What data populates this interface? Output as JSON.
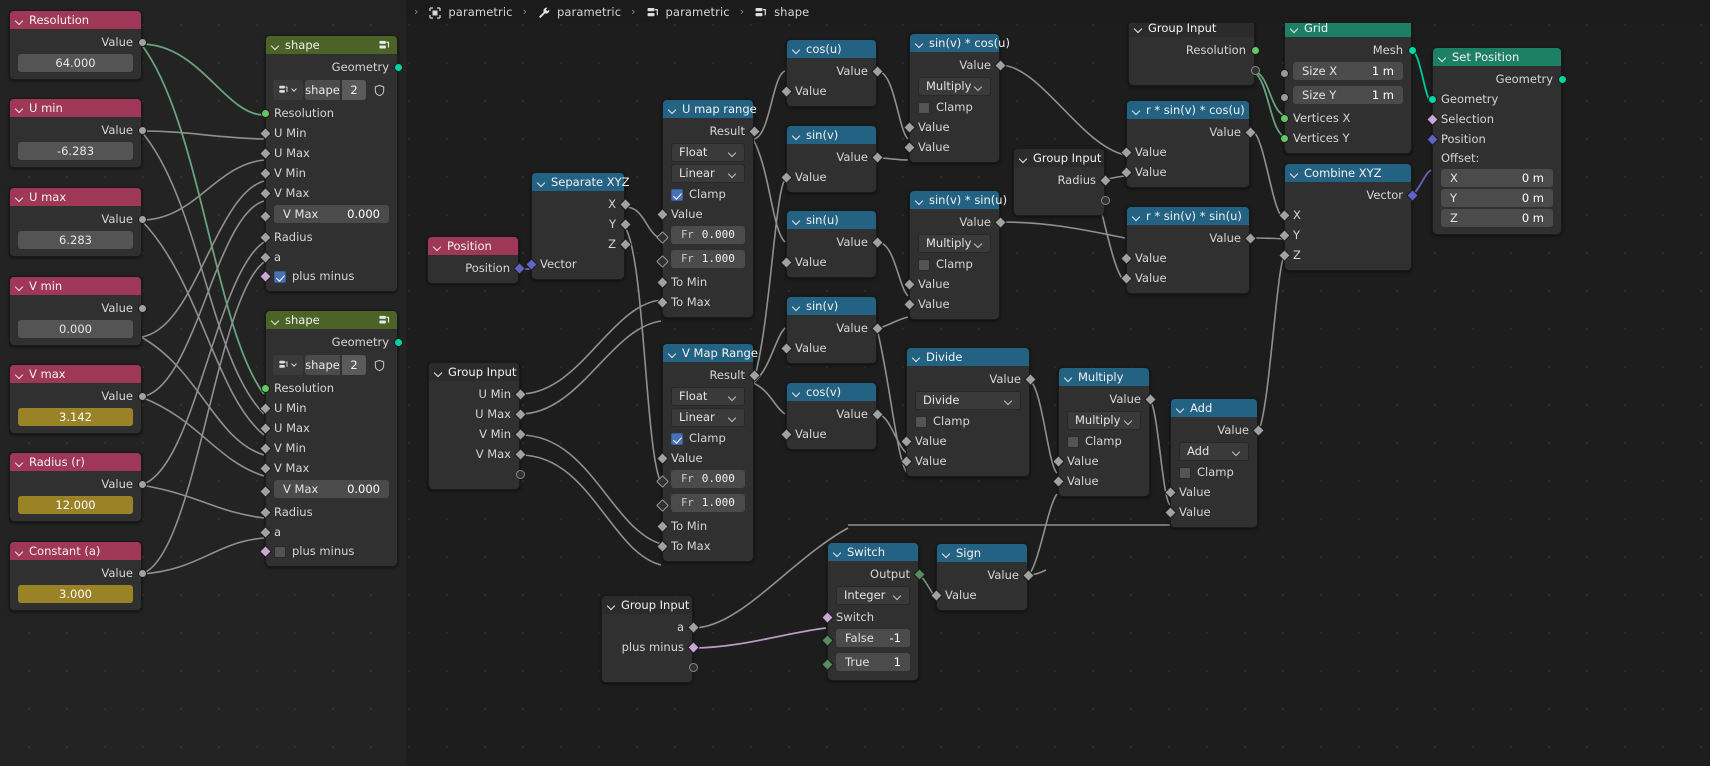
{
  "app": "blender-geometry-nodes",
  "breadcrumb": {
    "items": [
      {
        "icon": "object-icon",
        "label": "parametric"
      },
      {
        "icon": "wrench-icon",
        "label": "parametric"
      },
      {
        "icon": "nodetree-icon",
        "label": "parametric"
      },
      {
        "icon": "nodetree-icon",
        "label": "shape"
      }
    ],
    "separator": "›"
  },
  "colors": {
    "header_input": "#9f3759",
    "header_converter": "#246283",
    "header_geometry": "#1d8064",
    "header_group": "#4c6327",
    "header_groupinput": "#2b2b2b",
    "field_value": "#545454",
    "field_driven": "#9a8326",
    "socket_float": "#a1a1a1",
    "socket_geometry": "#00d6a3",
    "socket_vector": "#6363c7",
    "socket_boolean": "#cca6d6",
    "socket_integer": "#598c5c",
    "link_default": "#9a9a9a",
    "link_geometry": "#6fae86",
    "link_vector": "#6d6dc9",
    "link_boolean": "#c9a5d4"
  },
  "nodes": {
    "resolution": {
      "title": "Resolution",
      "out_label": "Value",
      "value": "64.000"
    },
    "u_min": {
      "title": "U min",
      "out_label": "Value",
      "value": "-6.283"
    },
    "u_max": {
      "title": "U max",
      "out_label": "Value",
      "value": "6.283"
    },
    "v_min": {
      "title": "V min",
      "out_label": "Value",
      "value": "0.000"
    },
    "v_max": {
      "title": "V max",
      "out_label": "Value",
      "value": "3.142"
    },
    "radius_r": {
      "title": "Radius (r)",
      "out_label": "Value",
      "value": "12.000"
    },
    "constant_a": {
      "title": "Constant (a)",
      "out_label": "Value",
      "value": "3.000"
    },
    "shape_group_1": {
      "title": "shape",
      "out_geometry": "Geometry",
      "id_name": "shape",
      "id_count": "2",
      "inputs": [
        "Resolution",
        "U Min",
        "U Max",
        "V Min",
        "V Max"
      ],
      "vmax_field": {
        "label": "V Max",
        "value": "0.000"
      },
      "inputs_tail": [
        "Radius",
        "a"
      ],
      "plus_minus": {
        "label": "plus minus",
        "checked": true
      }
    },
    "shape_group_2": {
      "title": "shape",
      "out_geometry": "Geometry",
      "id_name": "shape",
      "id_count": "2",
      "inputs": [
        "Resolution",
        "U Min",
        "U Max",
        "V Min",
        "V Max"
      ],
      "vmax_field": {
        "label": "V Max",
        "value": "0.000"
      },
      "inputs_tail": [
        "Radius",
        "a"
      ],
      "plus_minus": {
        "label": "plus minus",
        "checked": false
      }
    },
    "position": {
      "title": "Position",
      "out_label": "Position"
    },
    "separate_xyz": {
      "title": "Separate XYZ",
      "outputs": [
        "X",
        "Y",
        "Z"
      ],
      "input": "Vector"
    },
    "group_input_uv": {
      "title": "Group Input",
      "outputs": [
        "U Min",
        "U Max",
        "V Min",
        "V Max"
      ]
    },
    "group_input_radius": {
      "title": "Group Input",
      "outputs": [
        "Radius"
      ]
    },
    "group_input_resolution": {
      "title": "Group Input",
      "outputs": [
        "Resolution"
      ]
    },
    "group_input_a": {
      "title": "Group Input",
      "outputs": [
        "a",
        "plus minus"
      ]
    },
    "u_map_range": {
      "title": "U map range",
      "out_label": "Result",
      "data_type": "Float",
      "interpolation": "Linear",
      "clamp": {
        "label": "Clamp",
        "checked": true
      },
      "value_label": "Value",
      "from_min": {
        "prefix": "Fr",
        "value": "0.000"
      },
      "from_max": {
        "prefix": "Fr",
        "value": "1.000"
      },
      "to_min": "To Min",
      "to_max": "To Max"
    },
    "v_map_range": {
      "title": "V Map Range",
      "out_label": "Result",
      "data_type": "Float",
      "interpolation": "Linear",
      "clamp": {
        "label": "Clamp",
        "checked": true
      },
      "value_label": "Value",
      "from_min": {
        "prefix": "Fr",
        "value": "0.000"
      },
      "from_max": {
        "prefix": "Fr",
        "value": "1.000"
      },
      "to_min": "To Min",
      "to_max": "To Max"
    },
    "cos_u": {
      "title": "cos(u)",
      "out_label": "Value",
      "in_labels": [
        "Value"
      ]
    },
    "sin_v_a": {
      "title": "sin(v)",
      "out_label": "Value",
      "in_labels": [
        "Value"
      ]
    },
    "sin_u": {
      "title": "sin(u)",
      "out_label": "Value",
      "in_labels": [
        "Value"
      ]
    },
    "sin_v_b": {
      "title": "sin(v)",
      "out_label": "Value",
      "in_labels": [
        "Value"
      ]
    },
    "cos_v": {
      "title": "cos(v)",
      "out_label": "Value",
      "in_labels": [
        "Value"
      ]
    },
    "mul_sinv_cosu": {
      "title": "sin(v) * cos(u)",
      "out_label": "Value",
      "operation": "Multiply",
      "clamp": {
        "label": "Clamp",
        "checked": false
      },
      "in_labels": [
        "Value",
        "Value"
      ]
    },
    "mul_sinv_sinu": {
      "title": "sin(v) * sin(u)",
      "out_label": "Value",
      "operation": "Multiply",
      "clamp": {
        "label": "Clamp",
        "checked": false
      },
      "in_labels": [
        "Value",
        "Value"
      ]
    },
    "r_sinv_cosu": {
      "title": "r * sin(v) * cos(u)",
      "out_label": "Value",
      "in_labels": [
        "Value",
        "Value"
      ]
    },
    "r_sinv_sinu": {
      "title": "r * sin(v) * sin(u)",
      "out_label": "Value",
      "in_labels": [
        "Value",
        "Value"
      ]
    },
    "divide": {
      "title": "Divide",
      "out_label": "Value",
      "operation": "Divide",
      "clamp": {
        "label": "Clamp",
        "checked": false
      },
      "in_labels": [
        "Value",
        "Value"
      ]
    },
    "multiply": {
      "title": "Multiply",
      "out_label": "Value",
      "operation": "Multiply",
      "clamp": {
        "label": "Clamp",
        "checked": false
      },
      "in_labels": [
        "Value",
        "Value"
      ]
    },
    "add": {
      "title": "Add",
      "out_label": "Value",
      "operation": "Add",
      "clamp": {
        "label": "Clamp",
        "checked": false
      },
      "in_labels": [
        "Value",
        "Value"
      ]
    },
    "switch": {
      "title": "Switch",
      "out_label": "Output",
      "input_type": "Integer",
      "switch_label": "Switch",
      "false_field": {
        "label": "False",
        "value": "-1"
      },
      "true_field": {
        "label": "True",
        "value": "1"
      }
    },
    "sign": {
      "title": "Sign",
      "out_label": "Value",
      "in_labels": [
        "Value"
      ]
    },
    "grid": {
      "title": "Grid",
      "out_label": "Mesh",
      "size_x": {
        "label": "Size X",
        "value": "1 m"
      },
      "size_y": {
        "label": "Size Y",
        "value": "1 m"
      },
      "vertices_x": "Vertices X",
      "vertices_y": "Vertices Y"
    },
    "combine_xyz": {
      "title": "Combine XYZ",
      "out_label": "Vector",
      "in_labels": [
        "X",
        "Y",
        "Z"
      ]
    },
    "set_position": {
      "title": "Set Position",
      "out_label": "Geometry",
      "in_geometry": "Geometry",
      "in_selection": "Selection",
      "in_position": "Position",
      "offset_label": "Offset:",
      "offset": [
        {
          "label": "X",
          "value": "0 m"
        },
        {
          "label": "Y",
          "value": "0 m"
        },
        {
          "label": "Z",
          "value": "0 m"
        }
      ]
    }
  }
}
